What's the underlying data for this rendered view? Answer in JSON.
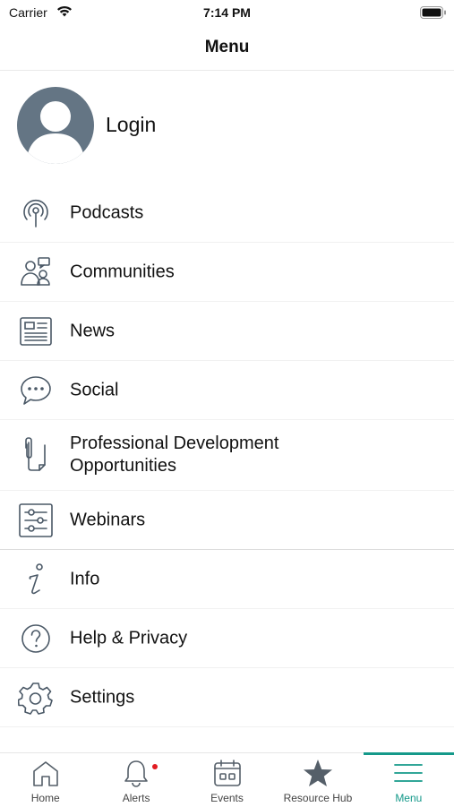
{
  "status_bar": {
    "carrier": "Carrier",
    "time": "7:14 PM"
  },
  "header": {
    "title": "Menu"
  },
  "login": {
    "label": "Login"
  },
  "menu": {
    "items": [
      {
        "label": "Podcasts",
        "icon": "podcast-icon"
      },
      {
        "label": "Communities",
        "icon": "communities-icon"
      },
      {
        "label": "News",
        "icon": "news-icon"
      },
      {
        "label": "Social",
        "icon": "chat-bubble-icon"
      },
      {
        "label": "Professional Development\nOpportunities",
        "icon": "paperclip-document-icon"
      },
      {
        "label": "Webinars",
        "icon": "sliders-icon"
      },
      {
        "label": "Info",
        "icon": "info-icon"
      },
      {
        "label": "Help & Privacy",
        "icon": "help-icon"
      },
      {
        "label": "Settings",
        "icon": "gear-icon"
      }
    ]
  },
  "tab_bar": {
    "active": "Menu",
    "accent_color": "#15998a",
    "tabs": [
      {
        "label": "Home",
        "icon": "home-icon"
      },
      {
        "label": "Alerts",
        "icon": "bell-icon",
        "badge": true
      },
      {
        "label": "Events",
        "icon": "calendar-icon"
      },
      {
        "label": "Resource Hub",
        "icon": "star-icon"
      },
      {
        "label": "Menu",
        "icon": "hamburger-icon"
      }
    ]
  }
}
